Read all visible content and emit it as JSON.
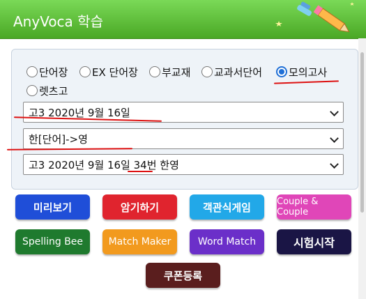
{
  "header": {
    "title": "AnyVoca 학습"
  },
  "radios": [
    {
      "label": "단어장",
      "checked": false
    },
    {
      "label": "EX 단어장",
      "checked": false
    },
    {
      "label": "부교재",
      "checked": false
    },
    {
      "label": "교과서단어",
      "checked": false
    },
    {
      "label": "모의고사",
      "checked": true
    },
    {
      "label": "렛츠고",
      "checked": false
    }
  ],
  "selects": {
    "exam": "고3 2020년 9월 16일",
    "mode": "한[단어]->영",
    "set": "고3 2020년 9월 16일 34번 한영"
  },
  "buttons": {
    "preview": "미리보기",
    "memorize": "암기하기",
    "quiz": "객관식게임",
    "couple": "Couple & Couple",
    "spelling": "Spelling Bee",
    "match_maker": "Match Maker",
    "word_match": "Word Match",
    "test_start": "시험시작",
    "coupon": "쿠폰등록"
  },
  "colors": {
    "header_green": "#5cbf34",
    "preview": "#1f4ed8",
    "memorize": "#e0242e",
    "quiz": "#22a8e8",
    "couple": "#e046b8",
    "spelling": "#1f7a2e",
    "match_maker": "#f29a1e",
    "word_match": "#6b2fc9",
    "test_start": "#1a1545",
    "coupon": "#5a1e1e"
  }
}
